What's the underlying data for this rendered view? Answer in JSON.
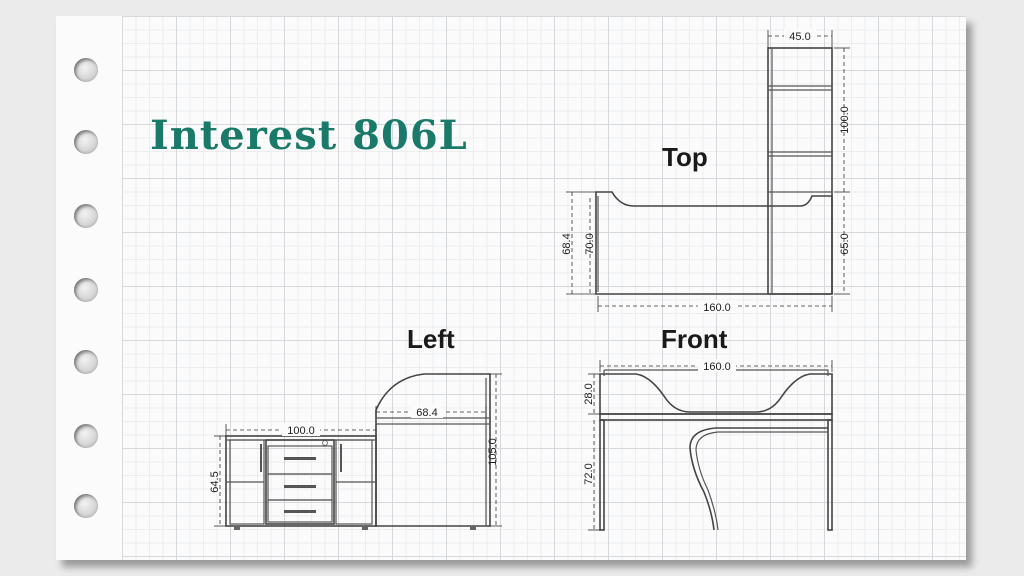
{
  "title": "Interest 806L",
  "views": {
    "top": {
      "label": "Top",
      "dims": {
        "width": "160.0",
        "depth_outer": "68.4",
        "depth_inner": "70.0",
        "shelf_width": "45.0",
        "shelf_depth": "100.0",
        "return_depth": "65.0"
      }
    },
    "left": {
      "label": "Left",
      "dims": {
        "cabinet_width": "100.0",
        "cabinet_height": "64.5",
        "top_depth": "68.4",
        "total_height": "105.0"
      }
    },
    "front": {
      "label": "Front",
      "dims": {
        "width": "160.0",
        "upper_height": "28.0",
        "lower_height": "72.0"
      }
    }
  }
}
